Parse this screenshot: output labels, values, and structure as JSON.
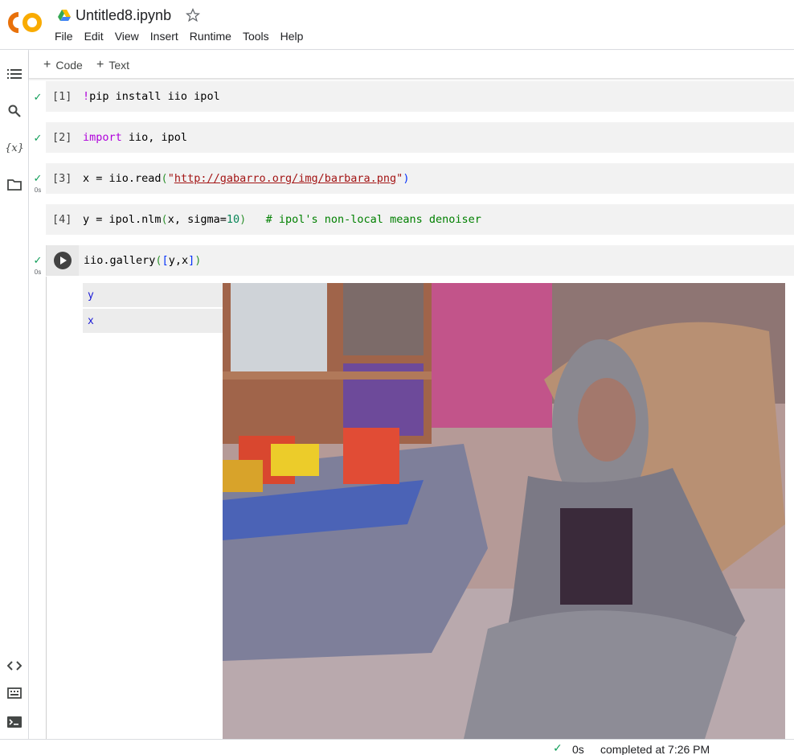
{
  "header": {
    "title": "Untitled8.ipynb",
    "menu": [
      "File",
      "Edit",
      "View",
      "Insert",
      "Runtime",
      "Tools",
      "Help"
    ]
  },
  "rail": {
    "icons": [
      "table-of-contents-icon",
      "search-icon",
      "variables-icon",
      "files-icon",
      "code-snippets-icon",
      "command-palette-icon",
      "terminal-icon"
    ],
    "variables_label": "{x}"
  },
  "toolbar": {
    "add_code_label": "Code",
    "add_text_label": "Text"
  },
  "cells": [
    {
      "prompt": "[1]",
      "executed": true,
      "time": ""
    },
    {
      "prompt": "[2]",
      "executed": true,
      "time": ""
    },
    {
      "prompt": "[3]",
      "executed": true,
      "time": "0s"
    },
    {
      "prompt": "[4]",
      "executed": false,
      "time": ""
    },
    {
      "prompt": "",
      "executed": true,
      "time": "0s"
    }
  ],
  "code": {
    "c1_bang": "!",
    "c1_rest": "pip install iio ipol",
    "c2_kw": "import",
    "c2_rest": " iio, ipol",
    "c3_a": "x = iio.read",
    "c3_p1": "(",
    "c3_q1": "\"",
    "c3_url": "http://gabarro.org/img/barbara.png",
    "c3_q2": "\"",
    "c3_p2": ")",
    "c4_a": "y = ipol.nlm",
    "c4_p1": "(",
    "c4_b": "x, sigma=",
    "c4_num": "10",
    "c4_p2": ")",
    "c4_sp": "   ",
    "c4_cmt": "# ipol's non-local means denoiser",
    "c5_a": "iio.gallery",
    "c5_p1": "(",
    "c5_b1": "[",
    "c5_b": "y,x",
    "c5_b2": "]",
    "c5_p2": ")"
  },
  "output": {
    "gallery_tabs": [
      "y",
      "x"
    ]
  },
  "status": {
    "time": "0s",
    "completed": "completed at 7:26 PM"
  },
  "colors": {
    "logo_orange": "#f9ab00",
    "logo_dark_orange": "#e8710a",
    "check_green": "#0f9d58",
    "keyword_purple": "#af00db",
    "string_red": "#a31515",
    "number_green": "#098658",
    "comment_green": "#008000"
  }
}
